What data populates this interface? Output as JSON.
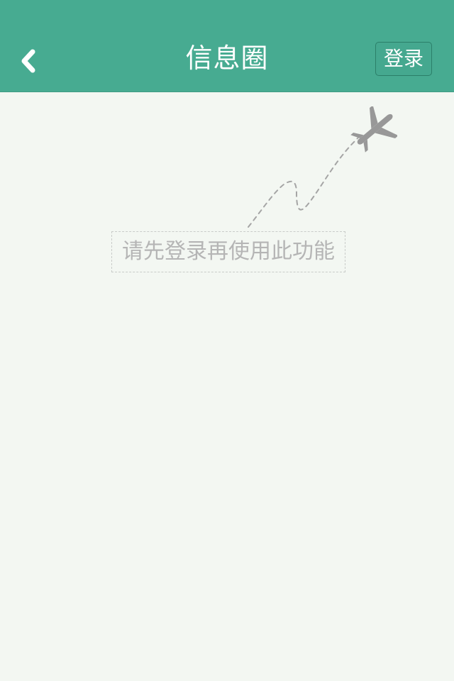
{
  "navbar": {
    "title": "信息圈",
    "back_icon": "chevron-left-icon",
    "login_label": "登录"
  },
  "content": {
    "message": "请先登录再使用此功能",
    "illustration_icon": "airplane-icon"
  },
  "colors": {
    "header": "#47ab91",
    "background": "#f3f7f2",
    "message_text": "#b5b5b5",
    "illustration": "#999999"
  }
}
